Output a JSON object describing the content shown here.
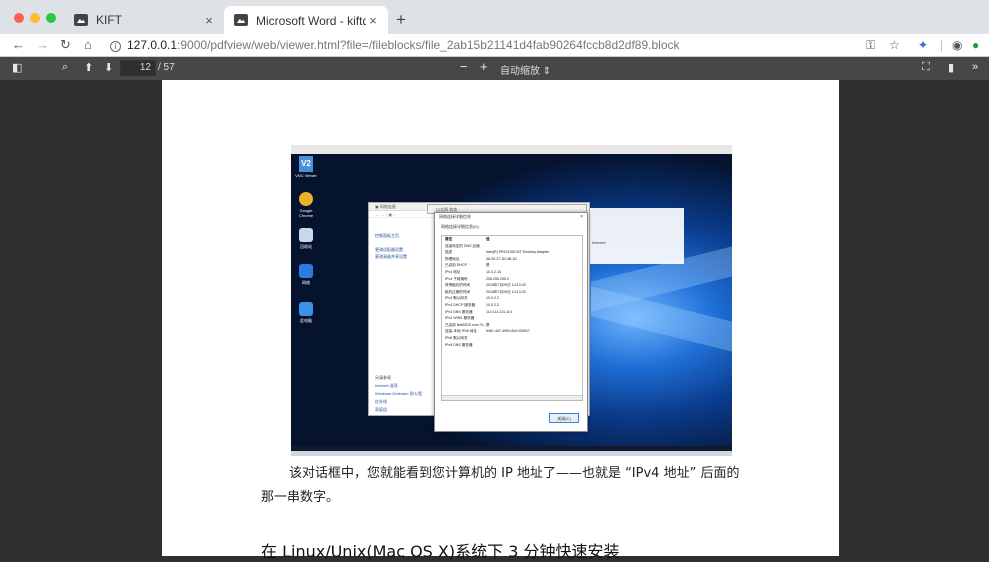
{
  "browser": {
    "tabs": [
      {
        "title": "KIFT",
        "close": "×",
        "active": false
      },
      {
        "title": "Microsoft Word - kiftd说明文档",
        "close": "×",
        "active": true
      }
    ],
    "new_tab": "+",
    "url": {
      "host": "127.0.0.1",
      "path": ":9000/pdfview/web/viewer.html?file=/fileblocks/file_2ab15b21141d4fab90264fccb8d2df89.block"
    }
  },
  "pdf_toolbar": {
    "page_number": "12",
    "page_total": "/ 57",
    "zoom_out": "−",
    "zoom_in": "+",
    "zoom": "自动缩放"
  },
  "screenshot": {
    "vnc_label": "VNC Viewer",
    "desktop_icons": [
      {
        "label": "Google Chrome",
        "color": "#e9b22a"
      },
      {
        "label": "回收站",
        "color": "#c8d7ea"
      },
      {
        "label": "网络",
        "color": "#2d7be0"
      },
      {
        "label": "此电脑",
        "color": "#3b93e6"
      }
    ],
    "control_panel": {
      "links": [
        "控制面板主页",
        "更改适配器设置",
        "更改高级共享设置"
      ],
      "see_also": [
        "另请参阅",
        "Internet 选项",
        "Windows Defender 防火墙",
        "红外线",
        "家庭组"
      ]
    },
    "side_text": "Internet",
    "side_text2": "Intel(R) PRO/1000 MT Desktop Adapter",
    "status_dialog_title": "以太网 状态",
    "details_dialog": {
      "title": "网络连接详细信息",
      "subtitle": "网络连接详细信息(D):",
      "header": {
        "k": "属性",
        "v": "值"
      },
      "rows": [
        {
          "k": "连接特定的 DNS 后缀",
          "v": ""
        },
        {
          "k": "描述",
          "v": "Intel(R) PRO/1000 MT Desktop Adapter"
        },
        {
          "k": "物理地址",
          "v": "08-00-27-30-4B-1D"
        },
        {
          "k": "已启用 DHCP",
          "v": "是"
        },
        {
          "k": "IPv4 地址",
          "v": "10.0.2.15"
        },
        {
          "k": "IPv4 子网掩码",
          "v": "255.255.255.0"
        },
        {
          "k": "获得租约的时间",
          "v": "2018年7月25日 14:13:43"
        },
        {
          "k": "租约过期的时间",
          "v": "2018年7月26日 14:13:43"
        },
        {
          "k": "IPv4 默认网关",
          "v": "10.0.2.2"
        },
        {
          "k": "IPv4 DHCP 服务器",
          "v": "10.0.2.2"
        },
        {
          "k": "IPv4 DNS 服务器",
          "v": "114.114.114.114"
        },
        {
          "k": "IPv4 WINS 服务器",
          "v": ""
        },
        {
          "k": "已启用 NetBIOS over Tc...",
          "v": "是"
        },
        {
          "k": "连接-本地 IPv6 地址",
          "v": "fe80::4d7:490f:c5c0:f33f%7"
        },
        {
          "k": "IPv6 默认网关",
          "v": ""
        },
        {
          "k": "IPv6 DNS 服务器",
          "v": ""
        }
      ],
      "close_button": "关闭(C)"
    }
  },
  "document": {
    "paragraph": "该对话框中，您就能看到您计算机的 IP 地址了——也就是 “IPv4 地址” 后面的那一串数字。",
    "heading": "在 Linux/Unix(Mac OS X)系统下 3 分钟快速安装"
  }
}
